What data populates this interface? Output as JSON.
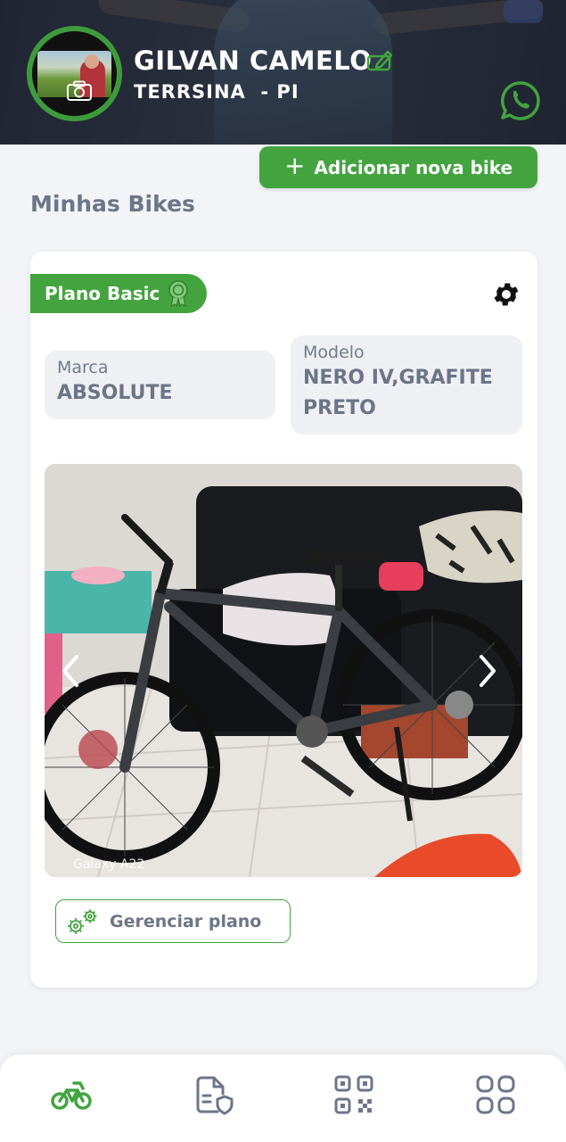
{
  "header": {
    "user_name": "GILVAN CAMELO",
    "location": "TERRSINA  - PI",
    "camera_icon": "camera-icon",
    "edit_icon": "edit-icon",
    "whatsapp_icon": "whatsapp-icon"
  },
  "actions": {
    "add_bike_label": "Adicionar nova bike",
    "add_bike_icon": "plus-icon"
  },
  "section": {
    "title": "Minhas Bikes"
  },
  "bike_card": {
    "plan_label": "Plano Basic",
    "plan_icon": "medal-icon",
    "settings_icon": "gear-icon",
    "brand_label": "Marca",
    "brand_value": "ABSOLUTE",
    "model_label": "Modelo",
    "model_value_line1": "NERO IV,GRAFITE",
    "model_value_line2": "PRETO",
    "photo_watermark": "Galaxy A22",
    "manage_plan_label": "Gerenciar plano",
    "manage_plan_icon": "gears-icon"
  },
  "bottom_nav": {
    "items": [
      {
        "icon": "bike-icon",
        "active": true
      },
      {
        "icon": "document-shield-icon",
        "active": false
      },
      {
        "icon": "qr-code-icon",
        "active": false
      },
      {
        "icon": "grid-icon",
        "active": false
      }
    ]
  },
  "colors": {
    "accent": "#43a43f",
    "text_muted": "#6d7588",
    "background": "#f3f4f7",
    "header_dark": "#2b3140"
  }
}
